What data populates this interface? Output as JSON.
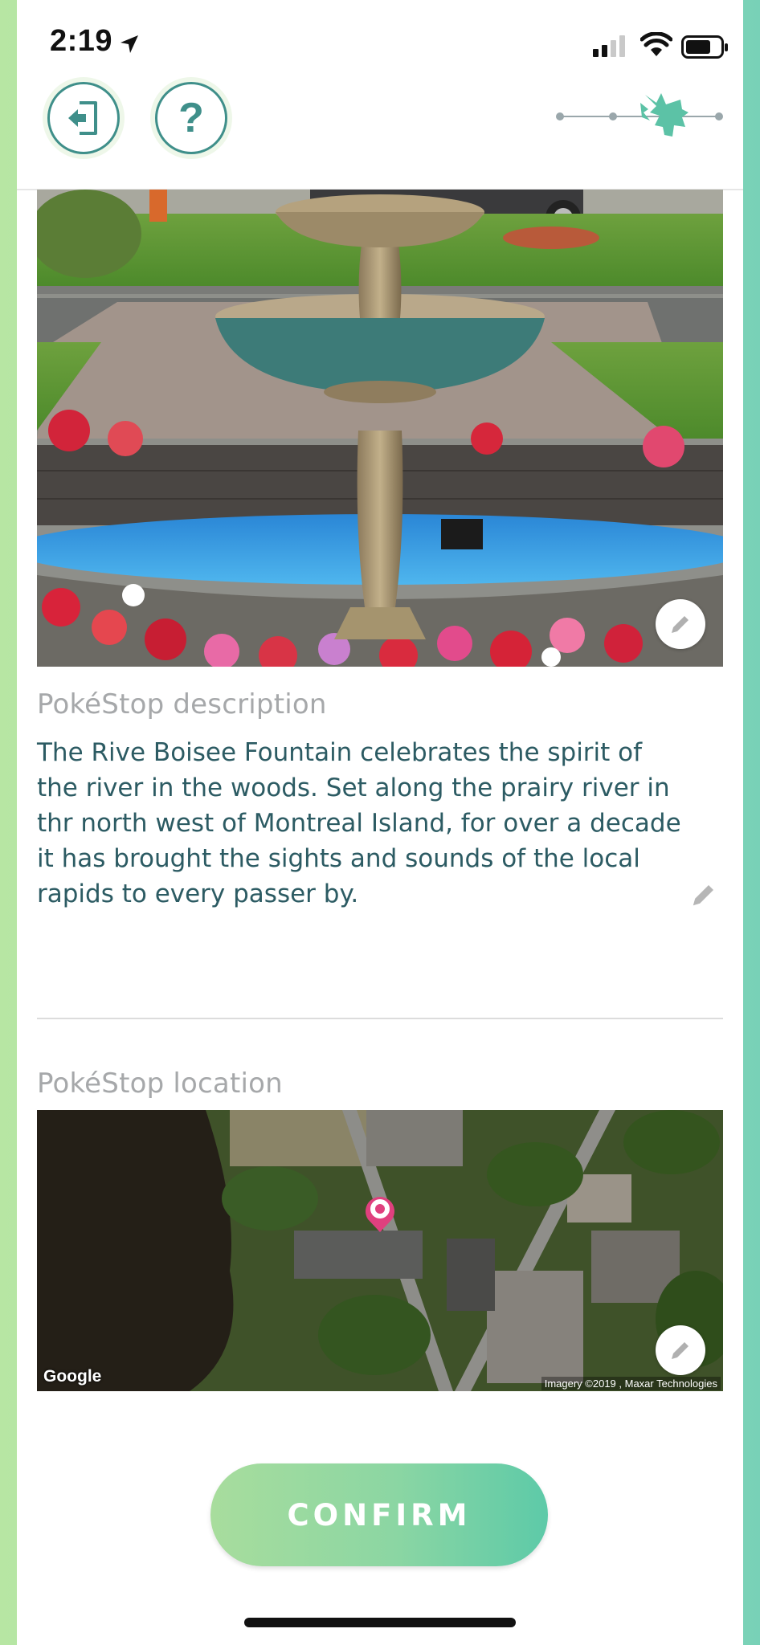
{
  "status_bar": {
    "time": "2:19",
    "icons": [
      "location-arrow-icon",
      "signal-icon",
      "wifi-icon",
      "battery-icon"
    ]
  },
  "header": {
    "exit_icon": "exit-door-icon",
    "help_label": "?",
    "progress_steps": 4,
    "progress_current_step": 3
  },
  "photo": {
    "edit_icon": "pencil-icon"
  },
  "description": {
    "label": "PokéStop description",
    "text": "The Rive Boisee Fountain celebrates the spirit of the river in the woods. Set along the prairy river in thr north west of Montreal Island, for over a decade it has brought the sights and sounds of the local rapids to every passer by.",
    "edit_icon": "pencil-icon"
  },
  "location": {
    "label": "PokéStop location",
    "map_provider": "Google",
    "attribution": "Imagery ©2019 , Maxar Technologies",
    "edit_icon": "pencil-icon"
  },
  "confirm": {
    "label": "CONFIRM"
  },
  "colors": {
    "accent_teal": "#3f8f8a",
    "description_text": "#2c5b63",
    "label_gray": "#a6a8aa",
    "confirm_gradient_start": "#a8dd9d",
    "confirm_gradient_end": "#5dcaa8"
  }
}
